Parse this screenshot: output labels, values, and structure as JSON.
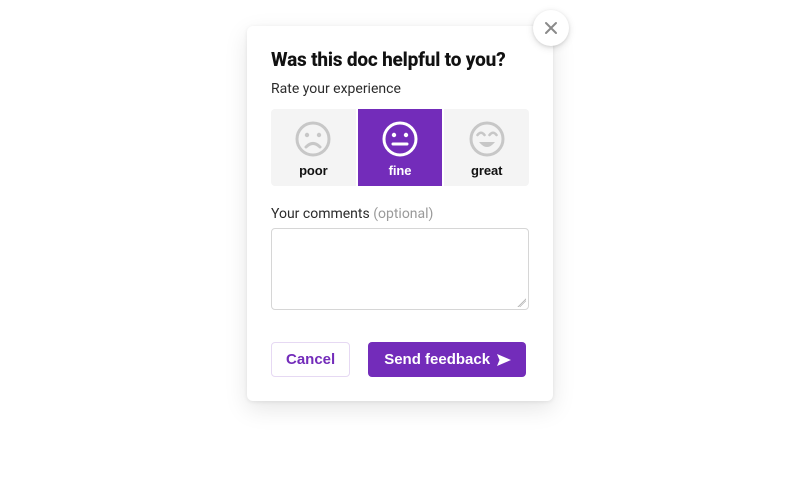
{
  "modal": {
    "title": "Was this doc helpful to you?",
    "subtitle": "Rate your experience",
    "ratings": [
      {
        "key": "poor",
        "label": "poor"
      },
      {
        "key": "fine",
        "label": "fine"
      },
      {
        "key": "great",
        "label": "great"
      }
    ],
    "selected_rating": "fine",
    "comments_label": "Your comments",
    "comments_optional": "(optional)",
    "comments_value": "",
    "actions": {
      "cancel": "Cancel",
      "send": "Send feedback"
    },
    "colors": {
      "accent": "#732cba",
      "option_bg": "#f4f4f4",
      "icon_muted": "#c7c7c7"
    }
  }
}
